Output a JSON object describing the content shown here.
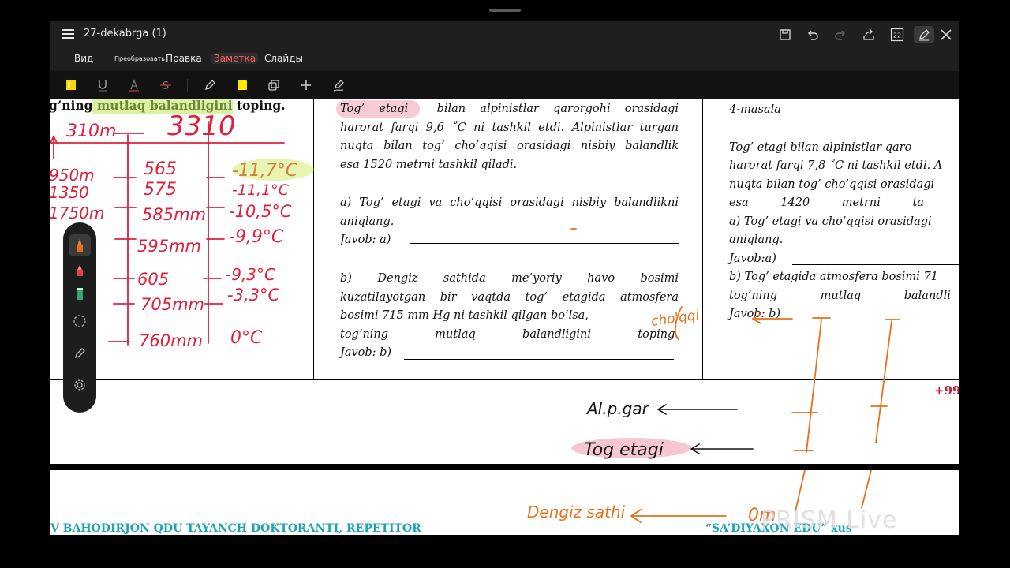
{
  "window": {
    "title": "27-dekabrga (1)"
  },
  "menu": {
    "items": [
      "Вид",
      "Преобразовать",
      "Правка",
      "Заметка",
      "Слайды"
    ],
    "selected": "Заметка"
  },
  "toolbar_right": {
    "page_count": "22"
  },
  "doc": {
    "left_col": {
      "top_text": "g’ning mutlaq balandligini toping.",
      "highlight": "mutlaq balandligini"
    },
    "mid_col": {
      "p1_highlight": "Tog’ etagi",
      "p1": [
        "bilan alpinistlar qarorgohi orasidagi",
        "harorat farqi 9,6 ˚C ni tashkil etdi. Alpinistlar turgan",
        "nuqta bilan tog’ cho’qqisi orasidagi nisbiy balandlik",
        "esa 1520 metrni tashkil qiladi."
      ],
      "qa": [
        "a) Tog’ etagi va cho’qqisi orasidagi nisbiy balandlikni",
        "aniqlang."
      ],
      "javob_a": "Javob: a)",
      "qb": [
        "b) Dengiz sathida me’yoriy havo bosimi",
        "kuzatilayotgan bir vaqtda tog’ etagida atmosfera",
        "bosimi 715 mm Hg ni tashkil qilgan bo’lsa,",
        "tog’ning mutlaq balandligini toping."
      ],
      "javob_b": "Javob: b)"
    },
    "right_col": {
      "title": "4-masala",
      "p1": [
        "Tog’ etagi bilan alpinistlar qaro",
        "harorat farqi 7,8 ˚C ni tashkil etdi. A",
        "nuqta bilan tog’ cho’qqisi orasidagi",
        "esa 1420 metrni ta"
      ],
      "qa": [
        "a) Tog’ etagi va cho’qqisi orasidagi",
        "aniqlang."
      ],
      "javob_a": "Javob:a)",
      "qb": [
        "b) Tog’ etagida atmosfera bosimi 71",
        "tog’ning mutlaq balandli"
      ],
      "javob_b": "Javob: b)"
    },
    "phone": "+99"
  },
  "handwriting": {
    "left": [
      "310m",
      "3310",
      "950m",
      "1350",
      "1750m",
      "565",
      "575",
      "585mm",
      "595mm",
      "605",
      "705mm",
      "760mm",
      "-11,7°C",
      "-11,1°C",
      "-10,5°C",
      "-9,9°C",
      "-9,3°C",
      "-3,3°C",
      "0°C"
    ],
    "notes": [
      "Al.p.gar",
      "Tog etagi",
      "Dengiz sathi",
      "0m",
      "cho'qqi"
    ]
  },
  "footer": {
    "left": "V BAHODIRJON QDU TAYANCH DOKTORANTI, REPETITOR",
    "right": "“SA’DIYAXON EDU” xus"
  },
  "watermark": "PRISM Live",
  "colors": {
    "ink_red": "#e0203c",
    "ink_orange": "#e8701a",
    "highlight_green": "#d4f06b",
    "highlight_pink": "#f2b8c2",
    "footer_teal": "#19a3b5"
  }
}
